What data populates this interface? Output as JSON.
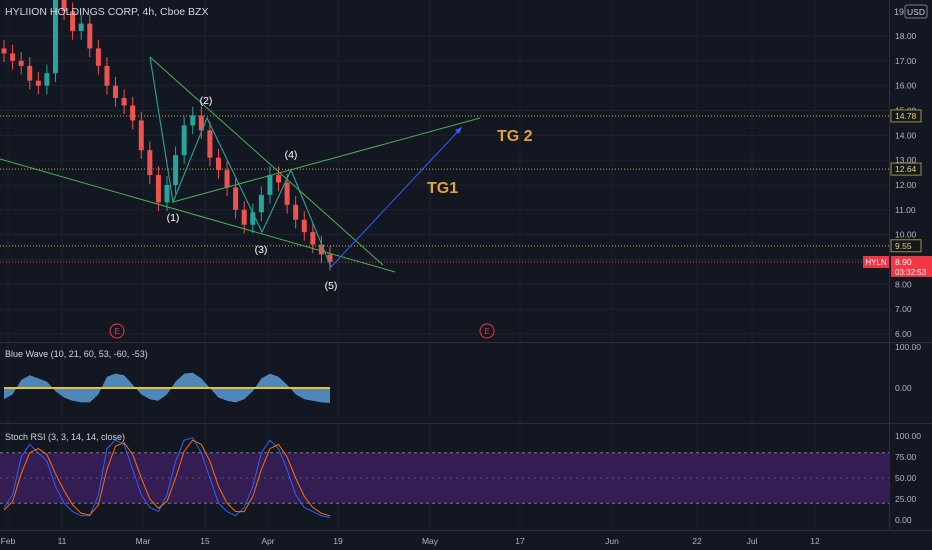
{
  "header": {
    "symbol_title": "HYLIION HOLDINGS CORP, 4h, Cboe BZX",
    "currency": "USD",
    "top_axis_label": "19"
  },
  "chart_data": [
    {
      "type": "candlestick",
      "pane": "price",
      "y_ticks": [
        "18.00",
        "17.00",
        "16.00",
        "15.00",
        "14.00",
        "13.00",
        "12.00",
        "11.00",
        "10.00",
        "9.00",
        "8.00",
        "7.00",
        "6.00"
      ],
      "ylim": [
        5.7,
        19.3
      ],
      "x_ticks": [
        "Feb",
        "11",
        "Mar",
        "15",
        "Apr",
        "19",
        "May",
        "17",
        "Jun",
        "22",
        "Jul",
        "12"
      ],
      "horizontal_levels": [
        {
          "value": 14.78,
          "label": "14.78"
        },
        {
          "value": 12.64,
          "label": "12.64"
        },
        {
          "value": 9.55,
          "label": "9.55"
        }
      ],
      "last_price": {
        "ticker": "HYLN",
        "value": "8.90",
        "countdown": "03:32:53"
      },
      "wave_labels": [
        "(1)",
        "(2)",
        "(3)",
        "(4)",
        "(5)"
      ],
      "targets": [
        "TG1",
        "TG 2"
      ],
      "event_markers": [
        "E",
        "E"
      ],
      "approx_closes": [
        17.3,
        17.0,
        16.8,
        16.2,
        16.0,
        16.5,
        20.5,
        19.0,
        18.2,
        18.5,
        17.5,
        16.8,
        16.0,
        15.5,
        15.2,
        14.6,
        13.4,
        12.4,
        11.3,
        12.0,
        13.2,
        14.4,
        14.8,
        14.2,
        13.1,
        12.6,
        11.9,
        11.0,
        10.4,
        10.9,
        11.6,
        12.4,
        12.1,
        11.2,
        10.6,
        10.1,
        9.6,
        9.2,
        8.9
      ]
    },
    {
      "type": "area",
      "pane": "indicator",
      "title": "Blue Wave (10, 21, 60, 53, -60, -53)",
      "y_ticks": [
        "100.00",
        "0.00"
      ]
    },
    {
      "type": "line",
      "pane": "indicator",
      "title": "Stoch RSI (3, 3, 14, 14, close)",
      "y_ticks": [
        "100.00",
        "75.00",
        "50.00",
        "25.00",
        "0.00"
      ],
      "band": [
        20,
        80
      ],
      "series": [
        {
          "color": "#2962ff",
          "values": [
            15,
            30,
            75,
            90,
            80,
            70,
            40,
            20,
            10,
            5,
            5,
            30,
            85,
            95,
            90,
            60,
            30,
            15,
            10,
            30,
            70,
            95,
            98,
            80,
            50,
            20,
            10,
            5,
            15,
            40,
            80,
            95,
            85,
            60,
            30,
            15,
            10,
            5,
            3
          ]
        },
        {
          "color": "#ff6d00",
          "values": [
            12,
            22,
            55,
            80,
            85,
            78,
            55,
            35,
            18,
            8,
            6,
            18,
            60,
            88,
            92,
            78,
            50,
            25,
            14,
            22,
            50,
            82,
            95,
            90,
            70,
            40,
            20,
            10,
            10,
            28,
            60,
            85,
            90,
            75,
            50,
            28,
            15,
            8,
            5
          ]
        }
      ]
    }
  ]
}
